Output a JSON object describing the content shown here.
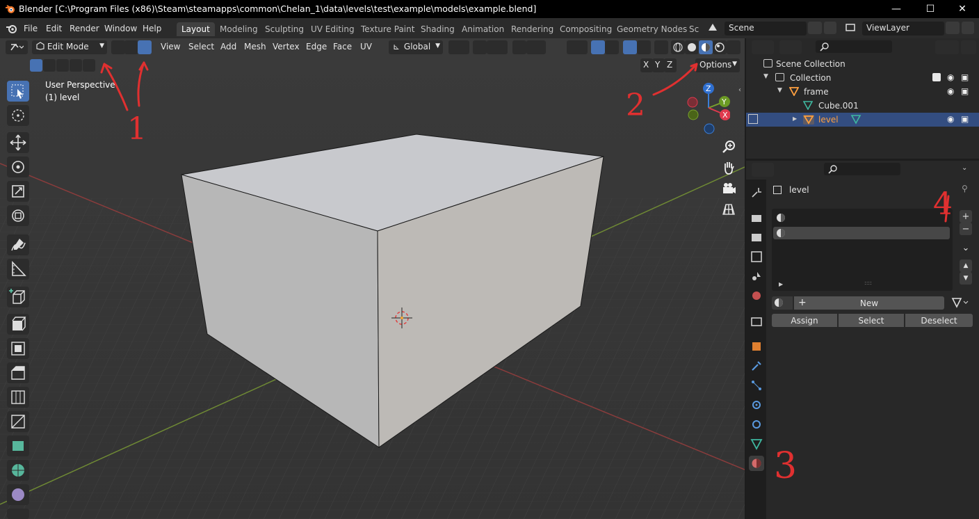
{
  "window": {
    "title": "Blender [C:\\Program Files (x86)\\Steam\\steamapps\\common\\Chelan_1\\data\\levels\\test\\example\\models\\example.blend]",
    "minimize": "—",
    "maximize": "☐",
    "close": "✕"
  },
  "menubar": {
    "items": [
      "File",
      "Edit",
      "Render",
      "Window",
      "Help"
    ],
    "workspaces": [
      "Layout",
      "Modeling",
      "Sculpting",
      "UV Editing",
      "Texture Paint",
      "Shading",
      "Animation",
      "Rendering",
      "Compositing",
      "Geometry Nodes",
      "Sc"
    ],
    "active_workspace": "Layout",
    "scene": "Scene",
    "view_layer": "ViewLayer"
  },
  "viewport_header": {
    "mode": "Edit Mode",
    "menus": [
      "View",
      "Select",
      "Add",
      "Mesh",
      "Vertex",
      "Edge",
      "Face",
      "UV"
    ],
    "transform_orientation": "Global",
    "options": "Options",
    "axes": [
      "X",
      "Y",
      "Z"
    ]
  },
  "viewport": {
    "view_name": "User Perspective",
    "object_name": "(1) level",
    "gizmo_axes": [
      "Z",
      "Y",
      "X"
    ]
  },
  "outliner": {
    "rows": [
      {
        "label": "Scene Collection"
      },
      {
        "label": "Collection"
      },
      {
        "label": "frame"
      },
      {
        "label": "Cube.001"
      },
      {
        "label": "level"
      }
    ]
  },
  "properties": {
    "object_name": "level",
    "material_buttons": {
      "new": "New",
      "assign": "Assign",
      "select": "Select",
      "deselect": "Deselect"
    },
    "add": "+",
    "remove": "−"
  },
  "annotations": [
    "1",
    "2",
    "3",
    "4"
  ],
  "colors": {
    "accent": "#4772b3",
    "selected_row": "#334d80",
    "annotation": "#e03030",
    "object_orange": "#ffa040",
    "mesh_teal": "#3fb8a0"
  }
}
